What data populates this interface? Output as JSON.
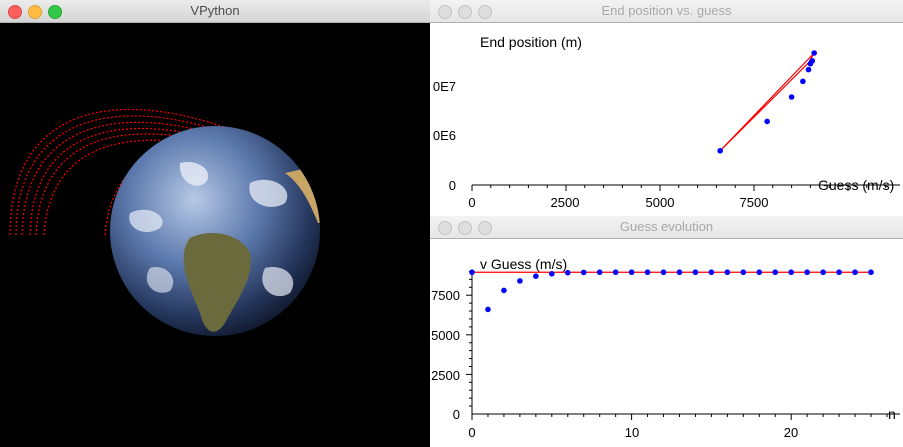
{
  "vpython_window": {
    "title": "VPython"
  },
  "graph1": {
    "title": "End position vs. guess",
    "ylabel": "End position (m)",
    "xlabel": "Guess (m/s)",
    "y_tick_labels": [
      "0",
      "0E6",
      "0E7"
    ],
    "x_tick_labels": [
      "0",
      "2500",
      "5000",
      "7500"
    ]
  },
  "graph2": {
    "title": "Guess evolution",
    "ylabel": "v Guess (m/s)",
    "xlabel": "n",
    "y_tick_labels": [
      "0",
      "2500",
      "5000",
      "7500"
    ],
    "x_tick_labels": [
      "0",
      "10",
      "20"
    ]
  },
  "colors": {
    "points": "#0000ff",
    "curve": "#ff0000",
    "trajectory": "#ff0000",
    "scene_bg": "#000000"
  },
  "icons": {
    "close": "close-icon",
    "minimize": "minimize-icon",
    "zoom": "zoom-icon"
  },
  "chart_data": [
    {
      "type": "scatter",
      "x": [
        6600,
        7850,
        8500,
        8800,
        8950,
        9000,
        9050,
        9100
      ],
      "series": [
        {
          "values": [
            35000000,
            65000000,
            90000000,
            106000000,
            118000000,
            124000000,
            127000000,
            135000000
          ]
        }
      ],
      "line_x": [
        6600,
        8950,
        9100,
        6600
      ],
      "line_y": [
        35000000,
        125000000,
        135000000,
        35000000
      ],
      "xlim": [
        0,
        9100
      ],
      "ylim": [
        0,
        135000000
      ],
      "grid": false
    },
    {
      "type": "scatter",
      "x": [
        0,
        1,
        2,
        3,
        4,
        5,
        6,
        7,
        8,
        9,
        10,
        11,
        12,
        13,
        14,
        15,
        16,
        17,
        18,
        19,
        20,
        21,
        22,
        23,
        24,
        25
      ],
      "series": [
        {
          "values": [
            8950,
            6600,
            7800,
            8400,
            8700,
            8850,
            8920,
            8940,
            8950,
            8950,
            8950,
            8950,
            8950,
            8950,
            8950,
            8950,
            8950,
            8950,
            8950,
            8950,
            8950,
            8950,
            8950,
            8950,
            8950,
            8950
          ]
        }
      ],
      "reference_line": 8950,
      "xlim": [
        0,
        25
      ],
      "ylim": [
        0,
        9000
      ],
      "grid": false
    }
  ]
}
